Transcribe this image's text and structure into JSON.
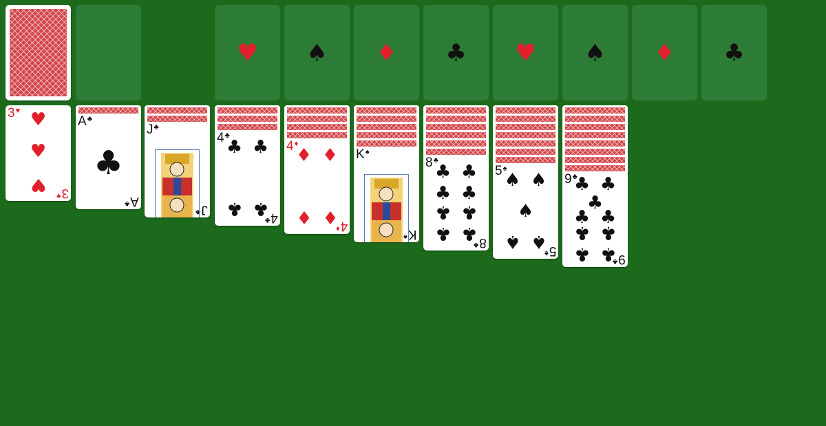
{
  "colors": {
    "felt": "#1c6a1c",
    "slot": "#2e7d36",
    "red": "#e0202c",
    "black": "#111111",
    "card_back": "#d4474c"
  },
  "stock": {
    "icon": "card-back"
  },
  "foundations": [
    {
      "suit": "♥",
      "color": "red"
    },
    {
      "suit": "♠",
      "color": "black"
    },
    {
      "suit": "♦",
      "color": "red"
    },
    {
      "suit": "♣",
      "color": "black"
    },
    {
      "suit": "♥",
      "color": "red"
    },
    {
      "suit": "♠",
      "color": "black"
    },
    {
      "suit": "♦",
      "color": "red"
    },
    {
      "suit": "♣",
      "color": "black"
    }
  ],
  "tableau": [
    {
      "hidden": 0,
      "card": {
        "rank": "3",
        "suit": "♥",
        "color": "red"
      }
    },
    {
      "hidden": 1,
      "card": {
        "rank": "A",
        "suit": "♣",
        "color": "black"
      }
    },
    {
      "hidden": 2,
      "card": {
        "rank": "J",
        "suit": "♣",
        "color": "black"
      }
    },
    {
      "hidden": 3,
      "card": {
        "rank": "4",
        "suit": "♣",
        "color": "black"
      }
    },
    {
      "hidden": 4,
      "card": {
        "rank": "4",
        "suit": "♦",
        "color": "red"
      }
    },
    {
      "hidden": 5,
      "card": {
        "rank": "K",
        "suit": "♠",
        "color": "black"
      }
    },
    {
      "hidden": 6,
      "card": {
        "rank": "8",
        "suit": "♣",
        "color": "black"
      }
    },
    {
      "hidden": 7,
      "card": {
        "rank": "5",
        "suit": "♠",
        "color": "black"
      }
    },
    {
      "hidden": 8,
      "card": {
        "rank": "9",
        "suit": "♣",
        "color": "black"
      }
    }
  ]
}
